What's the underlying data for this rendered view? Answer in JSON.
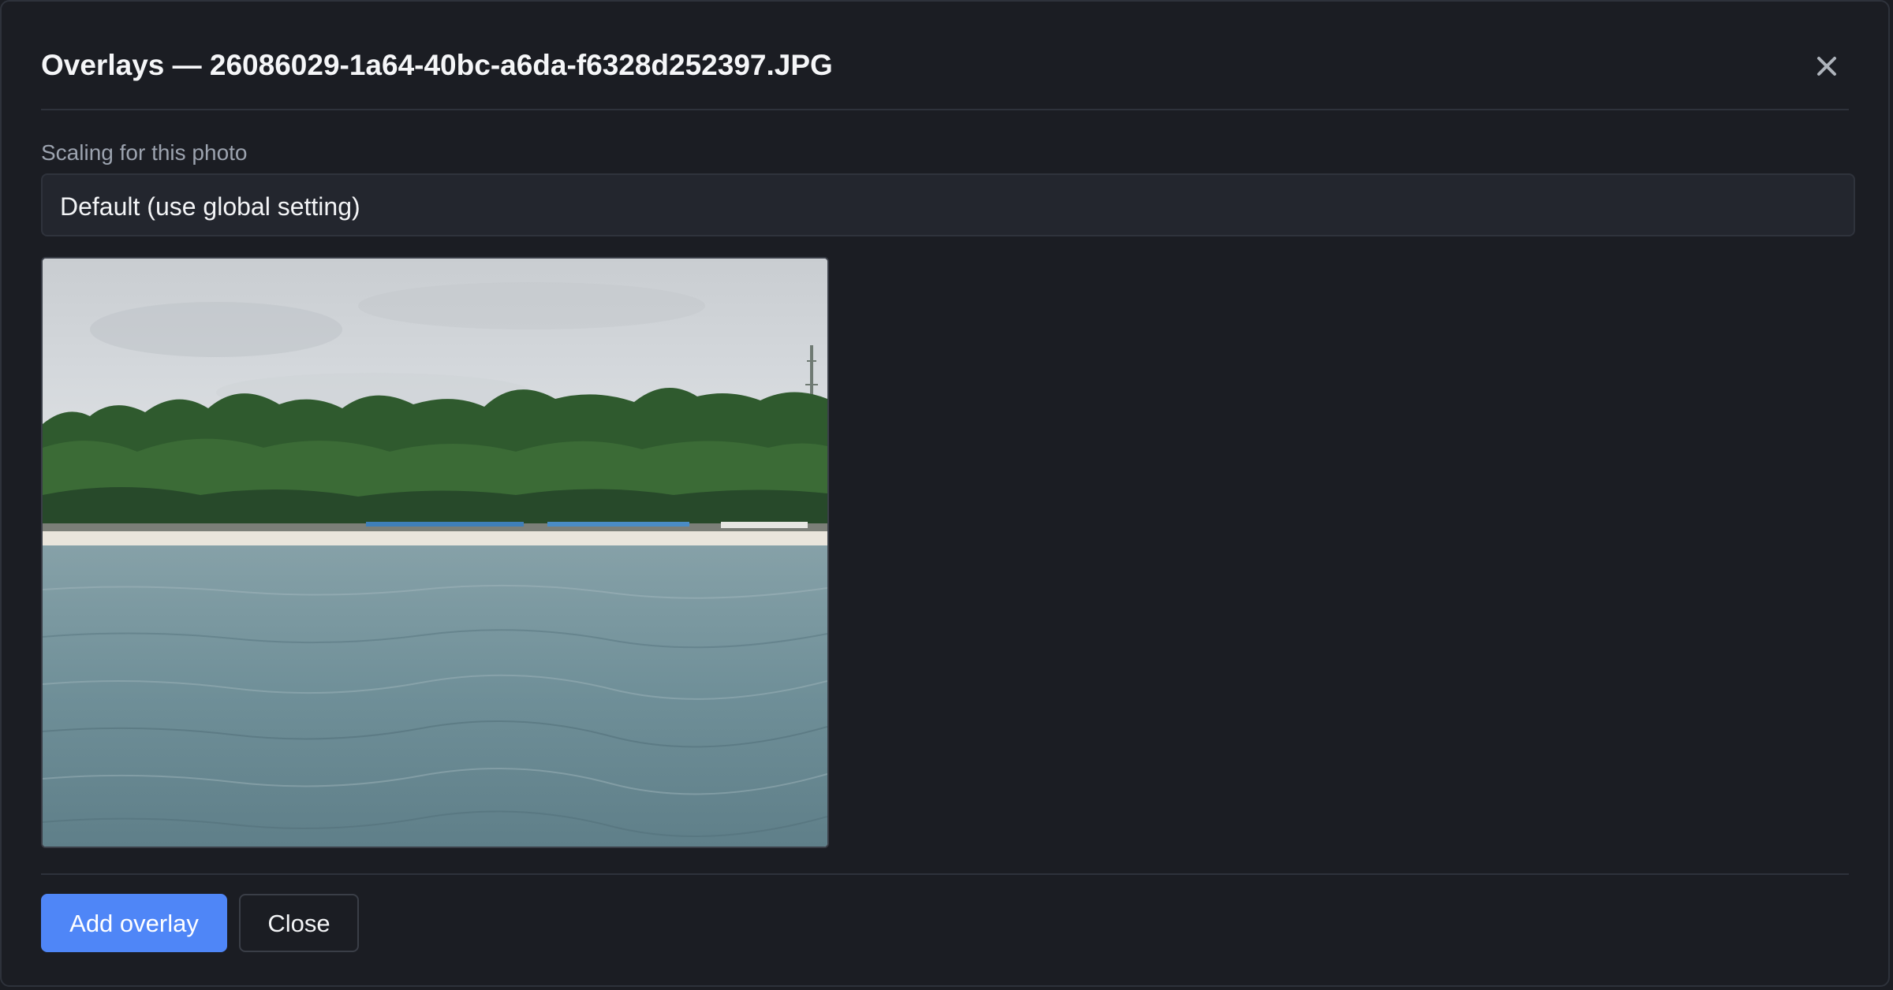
{
  "dialog": {
    "title": "Overlays — 26086029-1a64-40bc-a6da-f6328d252397.JPG",
    "close_icon": "close-icon"
  },
  "scaling": {
    "label": "Scaling for this photo",
    "selected_value": "Default (use global setting)"
  },
  "photo": {
    "subject": "beach-scene-photo"
  },
  "footer": {
    "add_overlay_label": "Add overlay",
    "close_label": "Close"
  },
  "colors": {
    "background": "#1b1d23",
    "accent": "#4f86f7",
    "border": "#2e323b",
    "muted_text": "#9ca3af"
  }
}
